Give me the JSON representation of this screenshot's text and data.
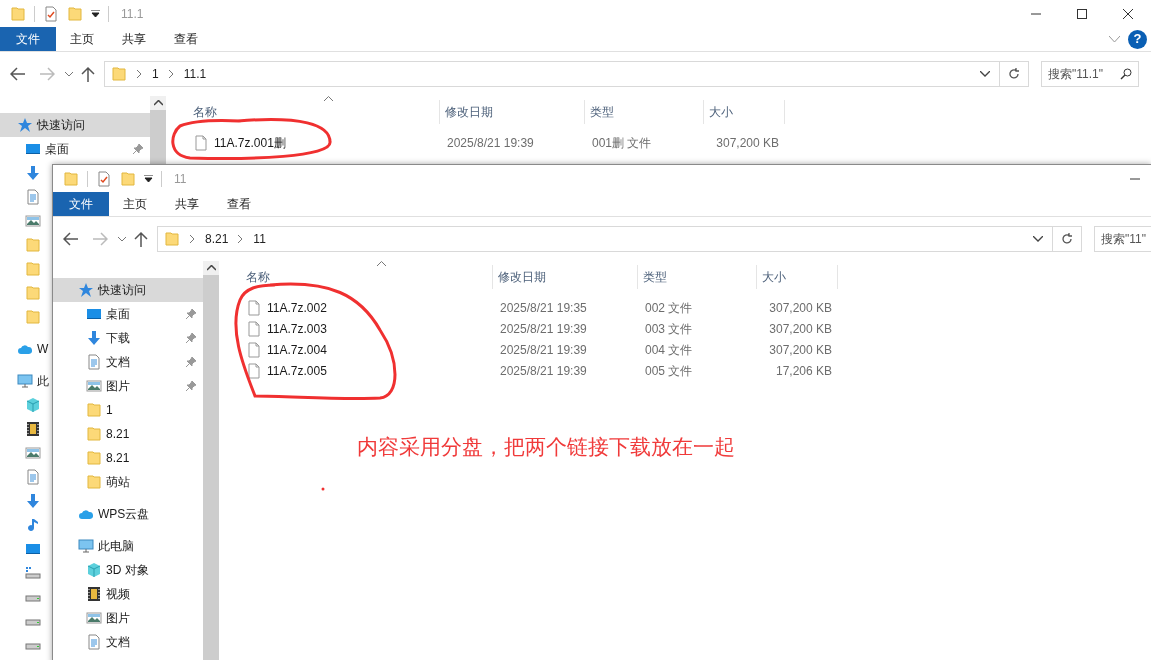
{
  "back_window": {
    "title": "11.1",
    "help_button": "?",
    "ribbon_tabs": [
      {
        "label": "文件",
        "selected": true
      },
      {
        "label": "主页",
        "selected": false
      },
      {
        "label": "共享",
        "selected": false
      },
      {
        "label": "查看",
        "selected": false
      }
    ],
    "breadcrumb": [
      "1",
      "11.1"
    ],
    "search": {
      "placeholder": "搜索\"11.1\""
    },
    "sidebar": [
      {
        "kind": "star",
        "label": "快速访问",
        "selected": true,
        "children": [
          {
            "kind": "desktop",
            "label": "桌面",
            "pinned": true
          },
          {
            "kind": "download"
          },
          {
            "kind": "doc"
          },
          {
            "kind": "picture"
          },
          {
            "kind": "folder"
          },
          {
            "kind": "folder"
          },
          {
            "kind": "folder"
          },
          {
            "kind": "folder"
          }
        ]
      },
      {
        "kind": "cloud",
        "label": "W"
      },
      {
        "kind": "pc",
        "label": "此",
        "children": [
          {
            "kind": "cube"
          },
          {
            "kind": "video"
          },
          {
            "kind": "picture"
          },
          {
            "kind": "doc"
          },
          {
            "kind": "download"
          },
          {
            "kind": "music"
          },
          {
            "kind": "desktop"
          },
          {
            "kind": "drive_win"
          },
          {
            "kind": "drive"
          },
          {
            "kind": "drive"
          },
          {
            "kind": "drive"
          }
        ]
      }
    ],
    "columns": [
      "名称",
      "修改日期",
      "类型",
      "大小"
    ],
    "files": [
      {
        "name": "11A.7z.001删",
        "date": "2025/8/21 19:39",
        "type": "001删 文件",
        "size": "307,200 KB"
      }
    ]
  },
  "front_window": {
    "title": "11",
    "ribbon_tabs": [
      {
        "label": "文件",
        "selected": true
      },
      {
        "label": "主页",
        "selected": false
      },
      {
        "label": "共享",
        "selected": false
      },
      {
        "label": "查看",
        "selected": false
      }
    ],
    "breadcrumb": [
      "8.21",
      "11"
    ],
    "search": {
      "placeholder": "搜索\"11\""
    },
    "sidebar": [
      {
        "kind": "star",
        "label": "快速访问",
        "selected": true,
        "children": [
          {
            "kind": "desktop",
            "label": "桌面",
            "pinned": true
          },
          {
            "kind": "download",
            "label": "下载",
            "pinned": true
          },
          {
            "kind": "doc",
            "label": "文档",
            "pinned": true
          },
          {
            "kind": "picture",
            "label": "图片",
            "pinned": true
          },
          {
            "kind": "folder",
            "label": "1",
            "pinned": false
          },
          {
            "kind": "folder",
            "label": "8.21",
            "pinned": false
          },
          {
            "kind": "folder",
            "label": "8.21",
            "pinned": false
          },
          {
            "kind": "folder",
            "label": "萌站",
            "pinned": false
          }
        ]
      },
      {
        "kind": "cloud",
        "label": "WPS云盘",
        "selected": false
      },
      {
        "kind": "pc",
        "label": "此电脑",
        "selected": false,
        "children": [
          {
            "kind": "cube",
            "label": "3D 对象"
          },
          {
            "kind": "video",
            "label": "视频"
          },
          {
            "kind": "picture",
            "label": "图片"
          },
          {
            "kind": "doc",
            "label": "文档"
          }
        ]
      }
    ],
    "columns": [
      "名称",
      "修改日期",
      "类型",
      "大小"
    ],
    "files": [
      {
        "name": "11A.7z.002",
        "date": "2025/8/21 19:35",
        "type": "002 文件",
        "size": "307,200 KB"
      },
      {
        "name": "11A.7z.003",
        "date": "2025/8/21 19:39",
        "type": "003 文件",
        "size": "307,200 KB"
      },
      {
        "name": "11A.7z.004",
        "date": "2025/8/21 19:39",
        "type": "004 文件",
        "size": "307,200 KB"
      },
      {
        "name": "11A.7z.005",
        "date": "2025/8/21 19:39",
        "type": "005 文件",
        "size": "17,206 KB"
      }
    ]
  },
  "annotation": {
    "text": "内容采用分盘，把两个链接下载放在一起"
  }
}
